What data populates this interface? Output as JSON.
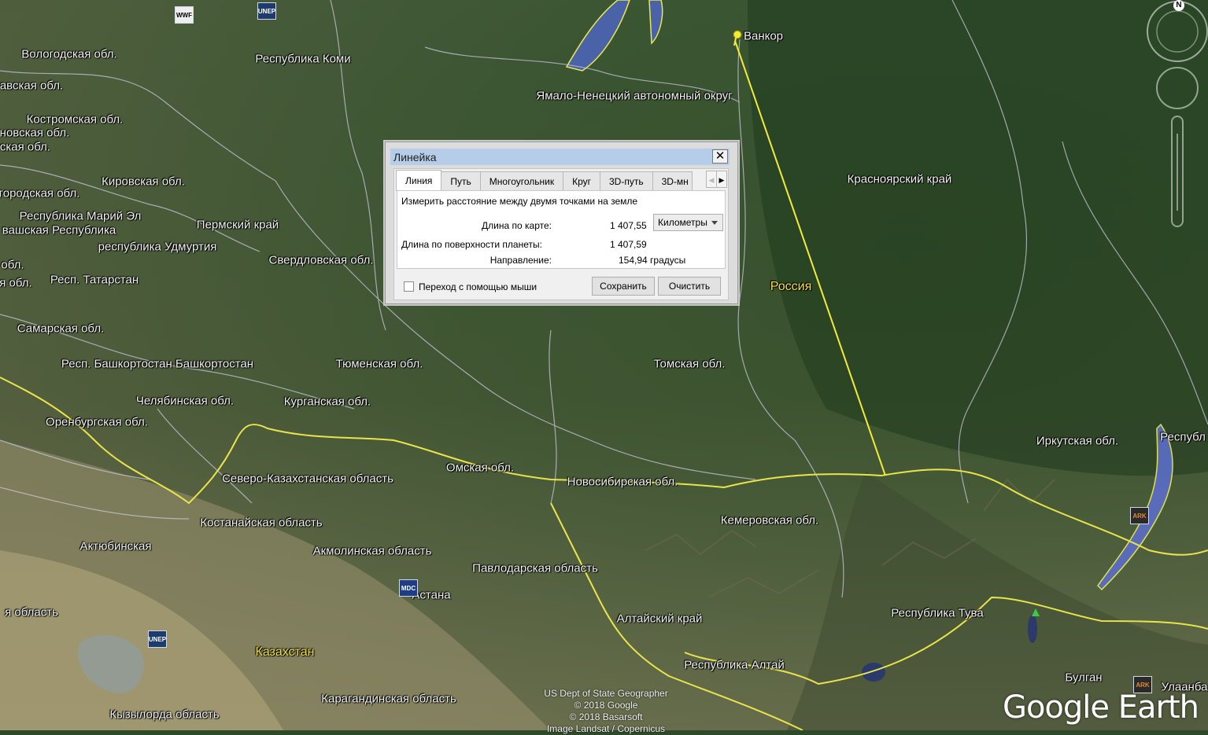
{
  "map": {
    "labels": [
      {
        "id": "komi",
        "text": "Республика Коми"
      },
      {
        "id": "vologda",
        "text": "Вологодская обл."
      },
      {
        "id": "xavskaya",
        "text": "авская обл."
      },
      {
        "id": "kostroma",
        "text": "Костромская обл."
      },
      {
        "id": "novskaya",
        "text": "новская обл."
      },
      {
        "id": "skaya",
        "text": "ская обл."
      },
      {
        "id": "kirov",
        "text": "Кировская обл."
      },
      {
        "id": "gorod",
        "text": "городская обл."
      },
      {
        "id": "mariel",
        "text": "Республика Марий Эл"
      },
      {
        "id": "chuvash",
        "text": "вашская Республика"
      },
      {
        "id": "perm",
        "text": "Пермский край"
      },
      {
        "id": "udmurt",
        "text": "республика Удмуртия"
      },
      {
        "id": "obl1",
        "text": "обл."
      },
      {
        "id": "sverdl",
        "text": "Свердловская обл."
      },
      {
        "id": "tatar",
        "text": "Респ. Татарстан"
      },
      {
        "id": "obl2",
        "text": "я обл."
      },
      {
        "id": "samara",
        "text": "Самарская обл."
      },
      {
        "id": "bashk",
        "text": "Респ. Башкортостан Башкортостан"
      },
      {
        "id": "tyumen",
        "text": "Тюменская обл."
      },
      {
        "id": "chelyab",
        "text": "Челябинская обл."
      },
      {
        "id": "kurgan",
        "text": "Курганская обл."
      },
      {
        "id": "orenb",
        "text": "Оренбургская обл."
      },
      {
        "id": "yamal",
        "text": "Ямало-Ненецкий автономный округ"
      },
      {
        "id": "krasnoyarsk",
        "text": "Красноярский край"
      },
      {
        "id": "tomsk",
        "text": "Томская обл."
      },
      {
        "id": "omsk",
        "text": "Омская обл."
      },
      {
        "id": "novosib",
        "text": "Новосибирская обл."
      },
      {
        "id": "sko",
        "text": "Северо-Казахстанская область"
      },
      {
        "id": "kostanay",
        "text": "Костанайская область"
      },
      {
        "id": "kemer",
        "text": "Кемеровская обл."
      },
      {
        "id": "irkutsk",
        "text": "Иркутская обл."
      },
      {
        "id": "respub",
        "text": "Республ"
      },
      {
        "id": "aktobe",
        "text": "Актюбинская"
      },
      {
        "id": "akmola",
        "text": "Акмолинская область"
      },
      {
        "id": "pavlodar",
        "text": "Павлодарская область"
      },
      {
        "id": "astana",
        "text": "Астана"
      },
      {
        "id": "altaikrai",
        "text": "Алтайский край"
      },
      {
        "id": "tuva",
        "text": "Республика Тува"
      },
      {
        "id": "oblast",
        "text": "я область"
      },
      {
        "id": "altairep",
        "text": "Республика Алтай"
      },
      {
        "id": "bulgan",
        "text": "Булган"
      },
      {
        "id": "ulan",
        "text": "Улаанба"
      },
      {
        "id": "karaganda",
        "text": "Карагандинская область"
      },
      {
        "id": "kyzylorda",
        "text": "Кызылордa область"
      }
    ],
    "countries": [
      {
        "id": "russia",
        "text": "Россия"
      },
      {
        "id": "kaz",
        "text": "Казахстан"
      }
    ],
    "placemark": {
      "text": "Ванкор"
    },
    "pois": [
      {
        "id": "wwf",
        "text": "WWF"
      },
      {
        "id": "unep1",
        "text": "UNEP"
      },
      {
        "id": "unep2",
        "text": "UNEP"
      },
      {
        "id": "mdc",
        "text": "MDC"
      },
      {
        "id": "ark1",
        "text": "ARK"
      },
      {
        "id": "ark2",
        "text": "ARK"
      }
    ],
    "attribution": [
      "US Dept of State Geographer",
      "© 2018 Google",
      "© 2018 Basarsoft",
      "Image Landsat / Copernicus"
    ],
    "logo": "Google Earth",
    "compass_letter": "N",
    "line_color": "#f2ec35"
  },
  "ruler": {
    "title": "Линейка",
    "close": "✕",
    "tabs": [
      "Линия",
      "Путь",
      "Многоугольник",
      "Круг",
      "3D-путь",
      "3D-мн"
    ],
    "active_tab": "Линия",
    "description": "Измерить расстояние между двумя точками на земле",
    "map_length_label": "Длина по карте:",
    "map_length_value": "1 407,55",
    "units": "Километры",
    "surface_length_label": "Длина по поверхности планеты:",
    "surface_length_value": "1 407,59",
    "heading_label": "Направление:",
    "heading_value": "154,94 градусы",
    "mouse_nav_label": "Переход с помощью мыши",
    "mouse_nav_checked": false,
    "save_label": "Сохранить",
    "clear_label": "Очистить",
    "tab_prev": "◀",
    "tab_next": "▶"
  }
}
